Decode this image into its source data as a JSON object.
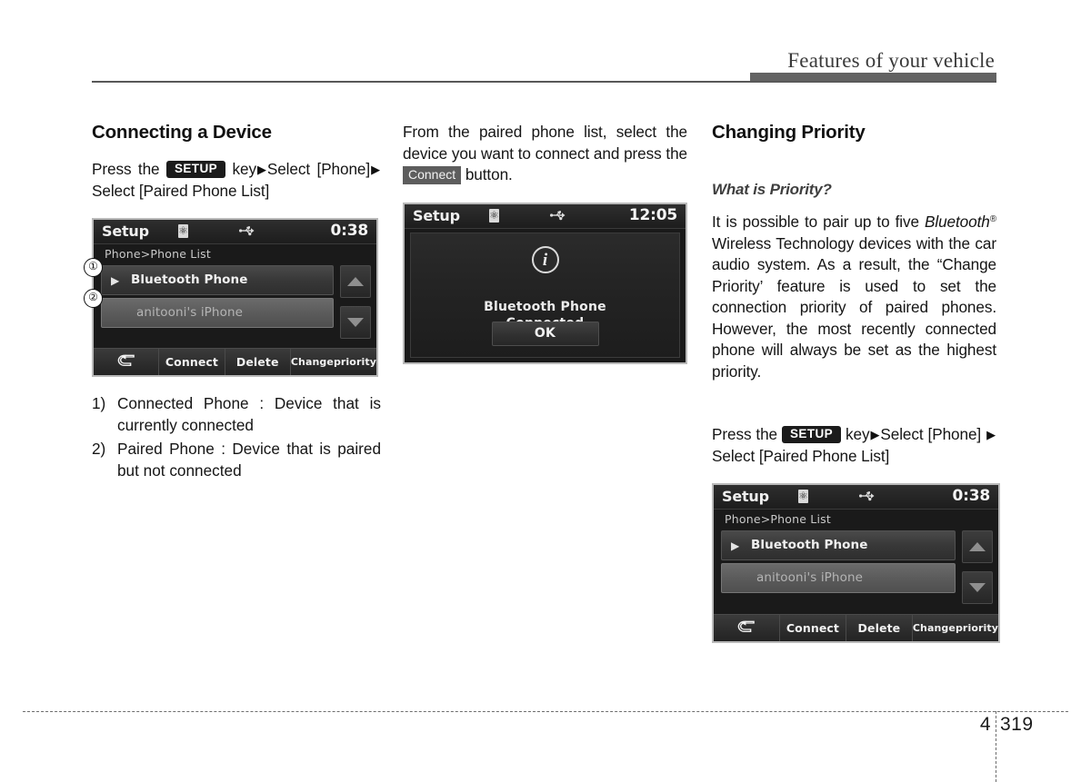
{
  "header": {
    "title": "Features of your vehicle"
  },
  "footer": {
    "chapter": "4",
    "page": "319"
  },
  "columns": {
    "left": {
      "section_title": "Connecting a Device",
      "instruction": {
        "part1": "Press   the",
        "key_label": "SETUP",
        "part2": "key",
        "arrow": "▶",
        "part3": "Select [Phone]",
        "part4": "Select [Paired Phone List]"
      },
      "notes": [
        {
          "num": "1)",
          "text": "Connected Phone : Device that is currently connected"
        },
        {
          "num": "2)",
          "text": "Paired Phone : Device that is paired but not connected"
        }
      ],
      "callouts": [
        {
          "label": "①"
        },
        {
          "label": "②"
        }
      ]
    },
    "middle": {
      "paragraph_before": "From the paired phone list, select the device you want to connect and press the",
      "key_label": "Connect",
      "paragraph_after": "button."
    },
    "right": {
      "section_title": "Changing Priority",
      "sub_title": "What is Priority?",
      "paragraph_1a": "It is possible to pair up to five",
      "brand": "Bluetooth",
      "brand_sup": "®",
      "paragraph_1b": "Wireless Technology devices with the car audio system. As a result, the “Change Priority’ feature is used to set the connection priority of paired phones. However, the most recently connected phone will always be set as the highest priority.",
      "instruction": {
        "part1": "Press   the",
        "key_label": "SETUP",
        "part2": "key",
        "arrow": "▶",
        "part3": "Select [Phone]",
        "part4": "Select [Paired Phone List]"
      }
    }
  },
  "screens": {
    "phone_list": {
      "status": {
        "title": "Setup",
        "bluetooth_icon": "bluetooth-icon",
        "usb_icon": "usb-icon",
        "time": "0:38"
      },
      "breadcrumb": "Phone>Phone List",
      "rows": [
        {
          "arrow": "▶",
          "label": "Bluetooth Phone",
          "state": "connected"
        },
        {
          "arrow": "",
          "label": "anitooni's iPhone",
          "state": "paired"
        }
      ],
      "scroll": {
        "up_icon": "caret-up-icon",
        "down_icon": "caret-down-icon"
      },
      "buttons": [
        {
          "label": "↩",
          "name": "back-button",
          "icon": true
        },
        {
          "label": "Connect",
          "name": "connect-button",
          "icon": false
        },
        {
          "label": "Delete",
          "name": "delete-button",
          "icon": false
        },
        {
          "label": "Change\npriority",
          "line1": "Change",
          "line2": "priority",
          "name": "change-priority-button",
          "icon": false
        }
      ]
    },
    "phone_list_2": {
      "status": {
        "title": "Setup",
        "time": "0:38"
      },
      "breadcrumb": "Phone>Phone List",
      "rows": [
        {
          "arrow": "▶",
          "label": "Bluetooth Phone",
          "state": "connected"
        },
        {
          "arrow": "",
          "label": "anitooni's iPhone",
          "state": "paired"
        }
      ],
      "buttons": [
        {
          "label": "↩"
        },
        {
          "label": "Connect"
        },
        {
          "label": "Delete"
        },
        {
          "line1": "Change",
          "line2": "priority"
        }
      ]
    },
    "connected_popup": {
      "status": {
        "title": "Setup",
        "time": "12:05"
      },
      "info_icon": "info-icon",
      "message_line1": "Bluetooth Phone",
      "message_line2": "Connected",
      "ok_label": "OK"
    }
  },
  "colors": {
    "header_bar": "#636363",
    "key_chip": "#1b1b1b",
    "soft_key": "#5d5d5d",
    "screen_bg": "#1a1a1a"
  }
}
